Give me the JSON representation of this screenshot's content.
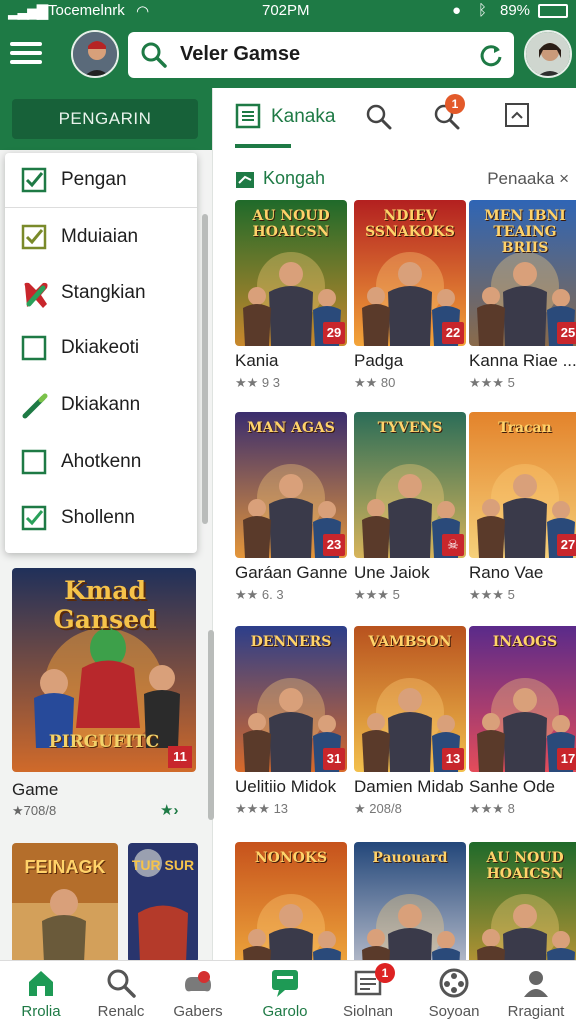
{
  "status_bar": {
    "carrier": "Tocemelnrk",
    "time": "702PM",
    "battery": "89%"
  },
  "header": {
    "search_text": "Veler Gamse",
    "icons": [
      "menu-icon",
      "avatar",
      "search-icon",
      "refresh-icon",
      "avatar"
    ]
  },
  "sidebar": {
    "button_label": "PENGARIN",
    "menu": [
      {
        "label": "Pengan",
        "icon": "checkbox-checked-icon",
        "checked": true
      },
      {
        "label": "Mduiaian",
        "icon": "checkbox-checked-icon",
        "checked": true
      },
      {
        "label": "Stangkian",
        "icon": "wand-icon",
        "checked": false
      },
      {
        "label": "Dkiakeoti",
        "icon": "checkbox-empty-icon",
        "checked": false
      },
      {
        "label": "Dkiakann",
        "icon": "pencil-icon",
        "checked": false
      },
      {
        "label": "Ahotkenn",
        "icon": "checkbox-empty-icon",
        "checked": false
      },
      {
        "label": "Shollenn",
        "icon": "checkbox-checked-icon",
        "checked": true
      }
    ],
    "featured": {
      "art_title": "Kmad Gansed",
      "art_subtitle": "PIRGUFITC",
      "badge": "11",
      "title": "Game",
      "meta": "★708/8"
    }
  },
  "main": {
    "tab_label": "Kanaka",
    "notification_count": "1",
    "section_title": "Kongah",
    "section_right": "Penaaka",
    "section_close": "×",
    "games": [
      {
        "name": "Kania",
        "meta": "★★ 9 3",
        "badge": "29",
        "art_text": "AU NOUD HOAICSN",
        "colors": [
          "#1f6a2a",
          "#c9882c"
        ]
      },
      {
        "name": "Padga",
        "meta": "★★ 80",
        "badge": "22",
        "art_text": "NDIEV SSNAKOKS",
        "colors": [
          "#b32020",
          "#f3a53a"
        ]
      },
      {
        "name": "Kanna Riae ...",
        "meta": "★★★ 5",
        "badge": "25",
        "art_text": "MEN IBNI TEAING BRIIS",
        "colors": [
          "#2f65b5",
          "#8a6a4a"
        ]
      },
      {
        "name": "Garáan Ganne",
        "meta": "★★ 6. 3",
        "badge": "23",
        "art_text": "MAN AGAS",
        "colors": [
          "#3a2d6e",
          "#e4963a"
        ]
      },
      {
        "name": "Une Jaiok",
        "meta": "★★★ 5",
        "badge": "☠",
        "art_text": "TYVENS",
        "colors": [
          "#2b6d58",
          "#d7b45a"
        ]
      },
      {
        "name": "Rano Vae",
        "meta": "★★★ 5",
        "badge": "27",
        "art_text": "Tracan",
        "colors": [
          "#e3832b",
          "#f6d07a"
        ]
      },
      {
        "name": "Uelitiio Midok",
        "meta": "★★★ 13",
        "badge": "31",
        "art_text": "DENNERS",
        "colors": [
          "#2c3e8a",
          "#d86a2a"
        ]
      },
      {
        "name": "Damien Midab",
        "meta": "★ 208/8",
        "badge": "13",
        "art_text": "VAMBSON",
        "colors": [
          "#b8521e",
          "#f2c04d"
        ]
      },
      {
        "name": "Sanhe Ode",
        "meta": "★★★ 8",
        "badge": "17",
        "art_text": "INAOGS",
        "colors": [
          "#5a2a8a",
          "#e44c5a"
        ]
      },
      {
        "name": "",
        "meta": "",
        "badge": "",
        "art_text": "NONOKS",
        "colors": [
          "#c6521c",
          "#f5b542"
        ]
      },
      {
        "name": "",
        "meta": "",
        "badge": "",
        "art_text": "Pauouard",
        "colors": [
          "#23477a",
          "#d0d0d8"
        ]
      },
      {
        "name": "",
        "meta": "",
        "badge": "",
        "art_text": "AU NOUD HOAICSN",
        "colors": [
          "#1f6a2a",
          "#d19b36"
        ]
      }
    ],
    "left_tiles": [
      {
        "art_text": "FEINAGK",
        "colors": [
          "#b46e2b",
          "#f2d28a"
        ]
      },
      {
        "art_text": "TUR SUR",
        "colors": [
          "#29356d",
          "#b43a2a"
        ]
      }
    ]
  },
  "bottom_nav": [
    {
      "label": "Rrolia",
      "icon": "home-icon",
      "active": true
    },
    {
      "label": "Renalc",
      "icon": "search-icon",
      "active": false
    },
    {
      "label": "Gabers",
      "icon": "gamepad-icon",
      "active": false
    },
    {
      "label": "Garolo",
      "icon": "chat-icon",
      "active": true
    },
    {
      "label": "Siolnan",
      "icon": "news-icon",
      "active": false,
      "badge": "1"
    },
    {
      "label": "Soyoan",
      "icon": "film-icon",
      "active": false
    },
    {
      "label": "Rragiant",
      "icon": "profile-icon",
      "active": false
    }
  ],
  "accent": "#1e7a45"
}
